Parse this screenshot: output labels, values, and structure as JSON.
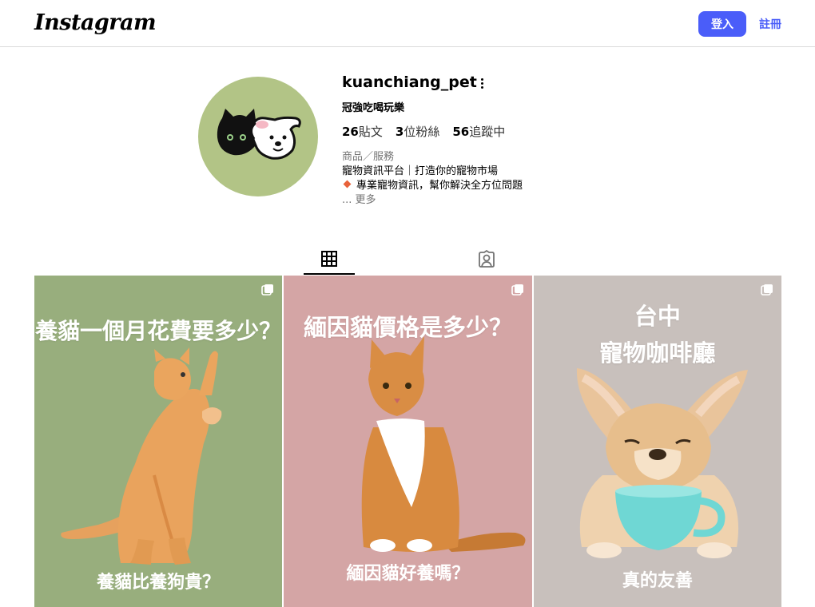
{
  "header": {
    "logo_text": "Instagram",
    "login_label": "登入",
    "signup_label": "註冊"
  },
  "profile": {
    "username": "kuanchiang_pet",
    "full_name": "冠強吃喝玩樂",
    "stats": [
      {
        "count": "26",
        "label": "貼文"
      },
      {
        "count": "3",
        "label": "位粉絲"
      },
      {
        "count": "56",
        "label": "追蹤中"
      }
    ],
    "category": "商品／服務",
    "bio_line1": "寵物資訊平台｜打造你的寵物市場",
    "bio_line2": "專業寵物資訊，幫你解決全方位問題",
    "more_label": "... 更多"
  },
  "tabs": [
    {
      "name": "posts",
      "icon": "grid-icon",
      "active": true
    },
    {
      "name": "tagged",
      "icon": "tagged-person-icon",
      "active": false
    }
  ],
  "posts": [
    {
      "title": "養貓一個月花費要多少？",
      "caption": "養貓比養狗貴？",
      "bg": "#98ae7d"
    },
    {
      "title": "緬因貓價格是多少？",
      "caption": "緬因貓好養嗎？",
      "bg": "#d4a5a5"
    },
    {
      "title_line1": "台中",
      "title_line2": "寵物咖啡廳",
      "caption": "真的友善",
      "bg": "#c8c0bc"
    }
  ],
  "colors": {
    "accent": "#4a5df9",
    "avatar_bg": "#b2c486"
  }
}
